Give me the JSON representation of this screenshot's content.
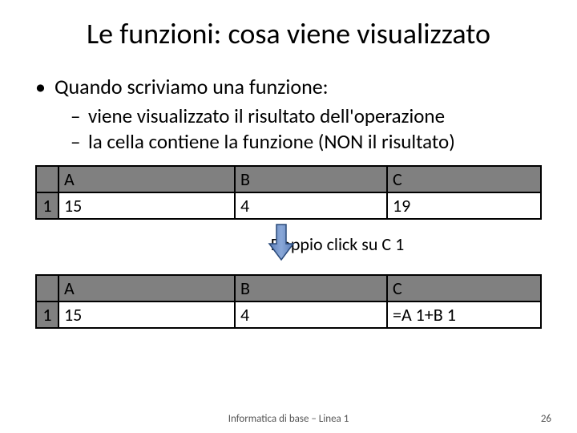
{
  "title": "Le funzioni: cosa viene visualizzato",
  "bullet_main": "Quando scriviamo una funzione:",
  "sub_bullets": [
    "viene visualizzato il risultato dell'operazione",
    "la cella contiene la funzione (NON il risultato)"
  ],
  "table1": {
    "headers": [
      "A",
      "B",
      "C"
    ],
    "row_num": "1",
    "cells": [
      "15",
      "4",
      "19"
    ]
  },
  "arrow_caption": "Doppio click su C 1",
  "table2": {
    "headers": [
      "A",
      "B",
      "C"
    ],
    "row_num": "1",
    "cells": [
      "15",
      "4",
      "=A 1+B 1"
    ]
  },
  "footer": "Informatica di base – Linea 1",
  "page_number": "26"
}
